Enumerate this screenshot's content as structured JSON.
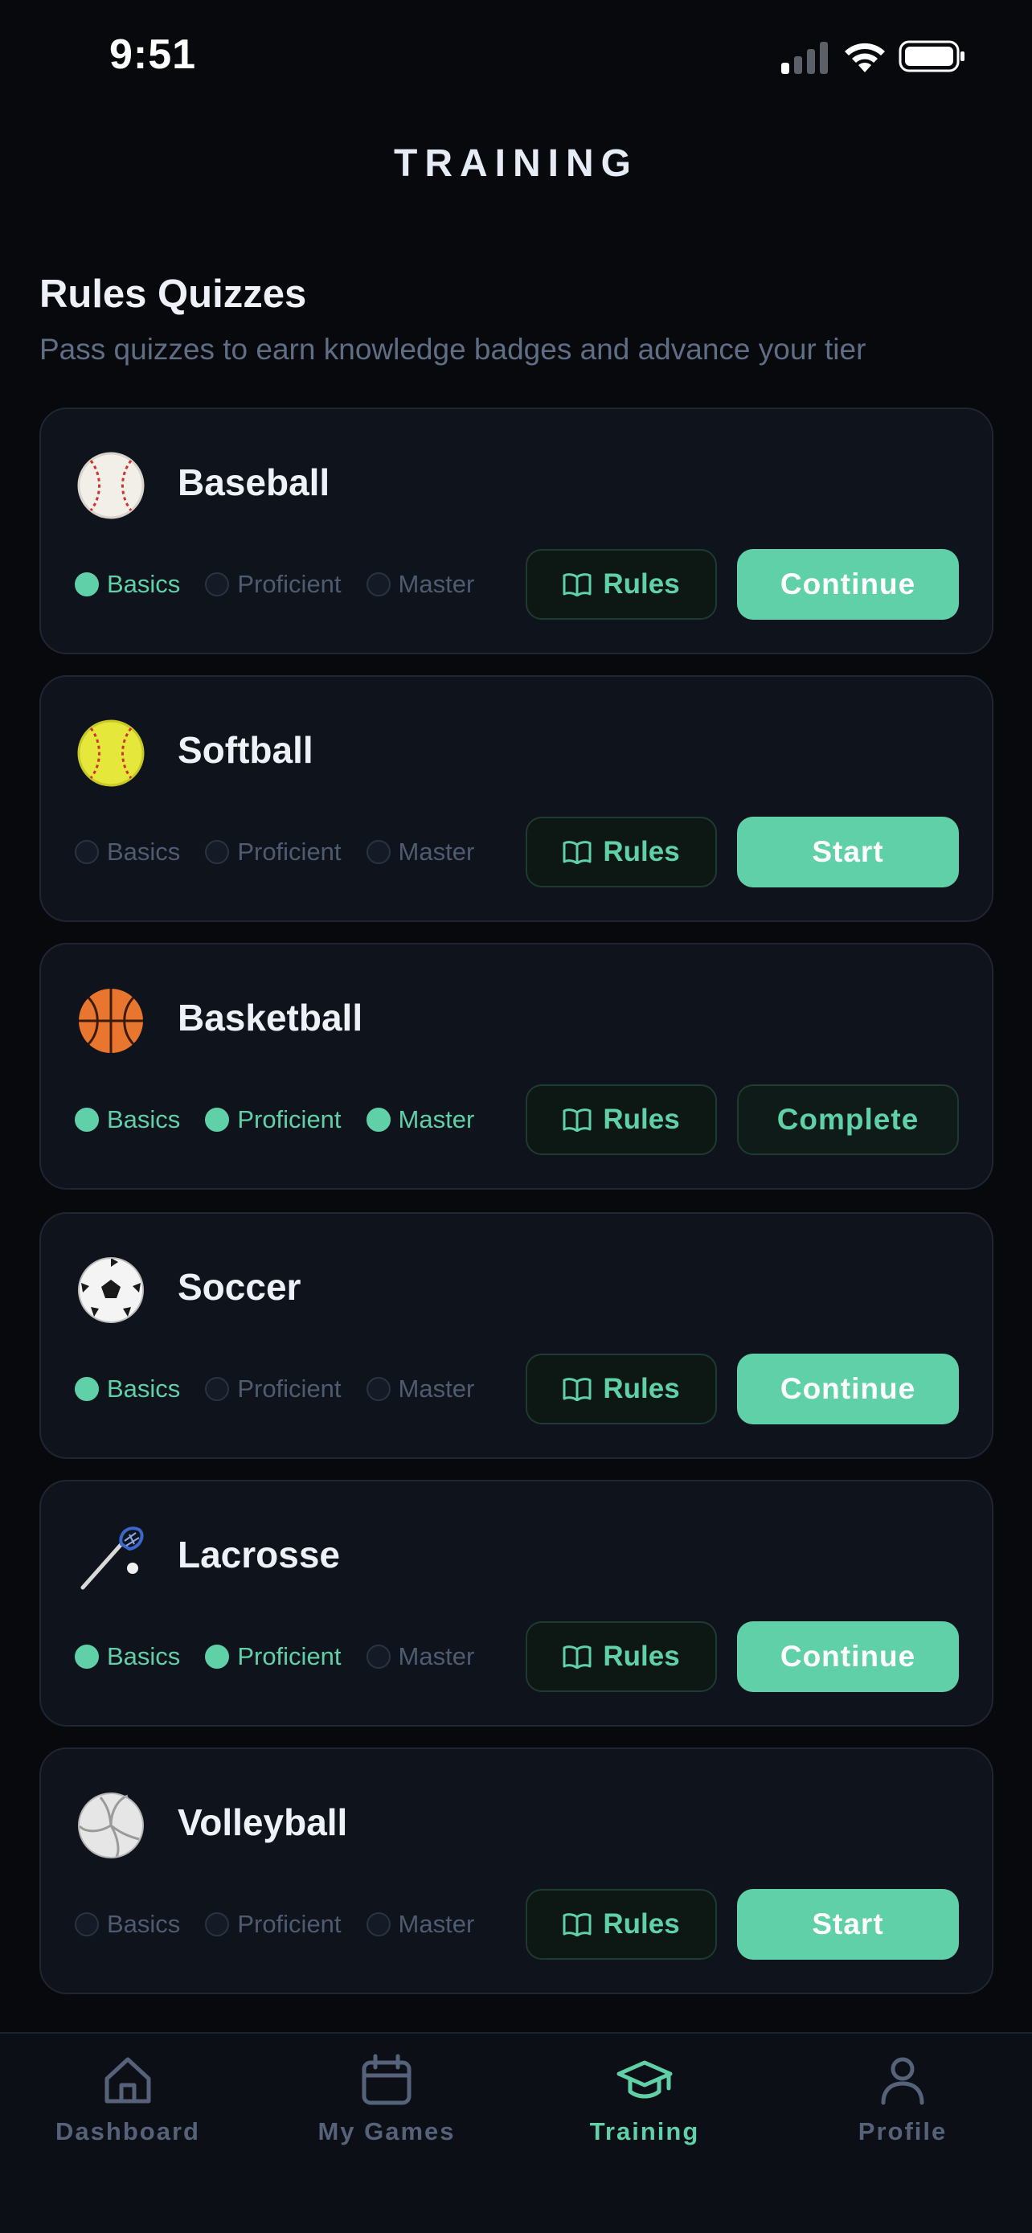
{
  "status_bar": {
    "time": "9:51"
  },
  "header": {
    "title": "TRAINING"
  },
  "section": {
    "title": "Rules Quizzes",
    "subtitle": "Pass quizzes to earn knowledge badges and advance your tier"
  },
  "tier_labels": [
    "Basics",
    "Proficient",
    "Master"
  ],
  "rules_label": "Rules",
  "cards": [
    {
      "sport": "Baseball",
      "icon": "baseball-icon",
      "tiers_done": [
        true,
        false,
        false
      ],
      "action": "Continue",
      "status": "in-progress"
    },
    {
      "sport": "Softball",
      "icon": "softball-icon",
      "tiers_done": [
        false,
        false,
        false
      ],
      "action": "Start",
      "status": "not-started"
    },
    {
      "sport": "Basketball",
      "icon": "basketball-icon",
      "tiers_done": [
        true,
        true,
        true
      ],
      "action": "Complete",
      "status": "complete"
    },
    {
      "sport": "Soccer",
      "icon": "soccer-ball-icon",
      "tiers_done": [
        true,
        false,
        false
      ],
      "action": "Continue",
      "status": "in-progress"
    },
    {
      "sport": "Lacrosse",
      "icon": "lacrosse-stick-icon",
      "tiers_done": [
        true,
        true,
        false
      ],
      "action": "Continue",
      "status": "in-progress"
    },
    {
      "sport": "Volleyball",
      "icon": "volleyball-icon",
      "tiers_done": [
        false,
        false,
        false
      ],
      "action": "Start",
      "status": "not-started"
    }
  ],
  "tab_bar": {
    "tabs": [
      {
        "label": "Dashboard",
        "icon": "home-icon",
        "active": false
      },
      {
        "label": "My Games",
        "icon": "calendar-icon",
        "active": false
      },
      {
        "label": "Training",
        "icon": "graduation-cap-icon",
        "active": true
      },
      {
        "label": "Profile",
        "icon": "person-icon",
        "active": false
      }
    ]
  },
  "colors": {
    "background": "#07090d",
    "card": "#0f131b",
    "accent": "#5fd0a8",
    "muted": "#56627a"
  }
}
